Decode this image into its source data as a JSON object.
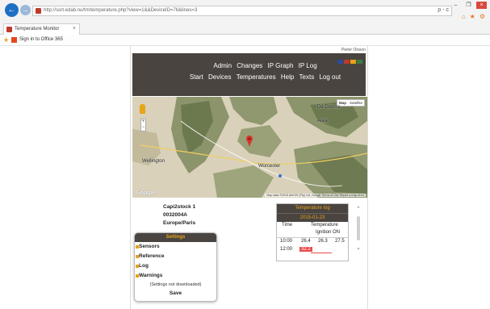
{
  "browser": {
    "url": "http://sort.edab.nu/tm/temperature.php?view=1&&DeviceID=76&lines=3",
    "tab_title": "Temperature Monitor",
    "tab_close": "×",
    "back_glyph": "←",
    "forward_glyph": "→",
    "address_icons": "ρ - c",
    "window_controls": [
      "–",
      "❐",
      "×"
    ],
    "right_icons": [
      "⌂",
      "★",
      "⚙"
    ],
    "favorite": "Sign in to Office 365"
  },
  "page": {
    "user": "Pieter Olsson",
    "menu_row1": [
      "Admin",
      "Changes",
      "IP Graph",
      "IP Log"
    ],
    "menu_row2": [
      "Start",
      "Devices",
      "Temperatures",
      "Help",
      "Texts",
      "Log out"
    ],
    "flags": [
      "#2b4c9b",
      "#c0392b",
      "#e8a317",
      "#3a7d44"
    ]
  },
  "map": {
    "type_options": [
      "Map",
      "Satellite"
    ],
    "zoom": [
      "+",
      "−"
    ],
    "labels": {
      "wellington": "Wellington",
      "worcester": "Worcester",
      "de_doorns": "De Doorns",
      "ceres_area": "Area",
      "google": "Google"
    },
    "footer": "Map data ©2015 AfriGIS (Pty) Ltd, Google   Terms of Use   Report a map error",
    "colors": {
      "terrain": "#d7cfb8",
      "mountain": "#7c8a5c",
      "pin": "#d8342a"
    }
  },
  "device": {
    "name": "Capi2stock 1",
    "id": "0032004A",
    "timezone": "Europe/Paris"
  },
  "temp_log": {
    "title": "Temperature log",
    "date": "2015-01-23",
    "col_time": "Time",
    "col_temp": "Temperature",
    "ignition": "Ignition ON",
    "rows": [
      {
        "time": "10:00",
        "v1": "26.4",
        "v2": "26.3",
        "v3": "27.5"
      },
      {
        "time": "12:00",
        "v1": "32.2",
        "v2": "",
        "v3": ""
      }
    ],
    "scroll_up": "⌃",
    "scroll_down": "⌄"
  },
  "settings": {
    "title": "Settings",
    "items": [
      "Sensors",
      "Reference",
      "Log",
      "Warnings"
    ],
    "note": "(Settings not downloaded)",
    "save": "Save"
  }
}
